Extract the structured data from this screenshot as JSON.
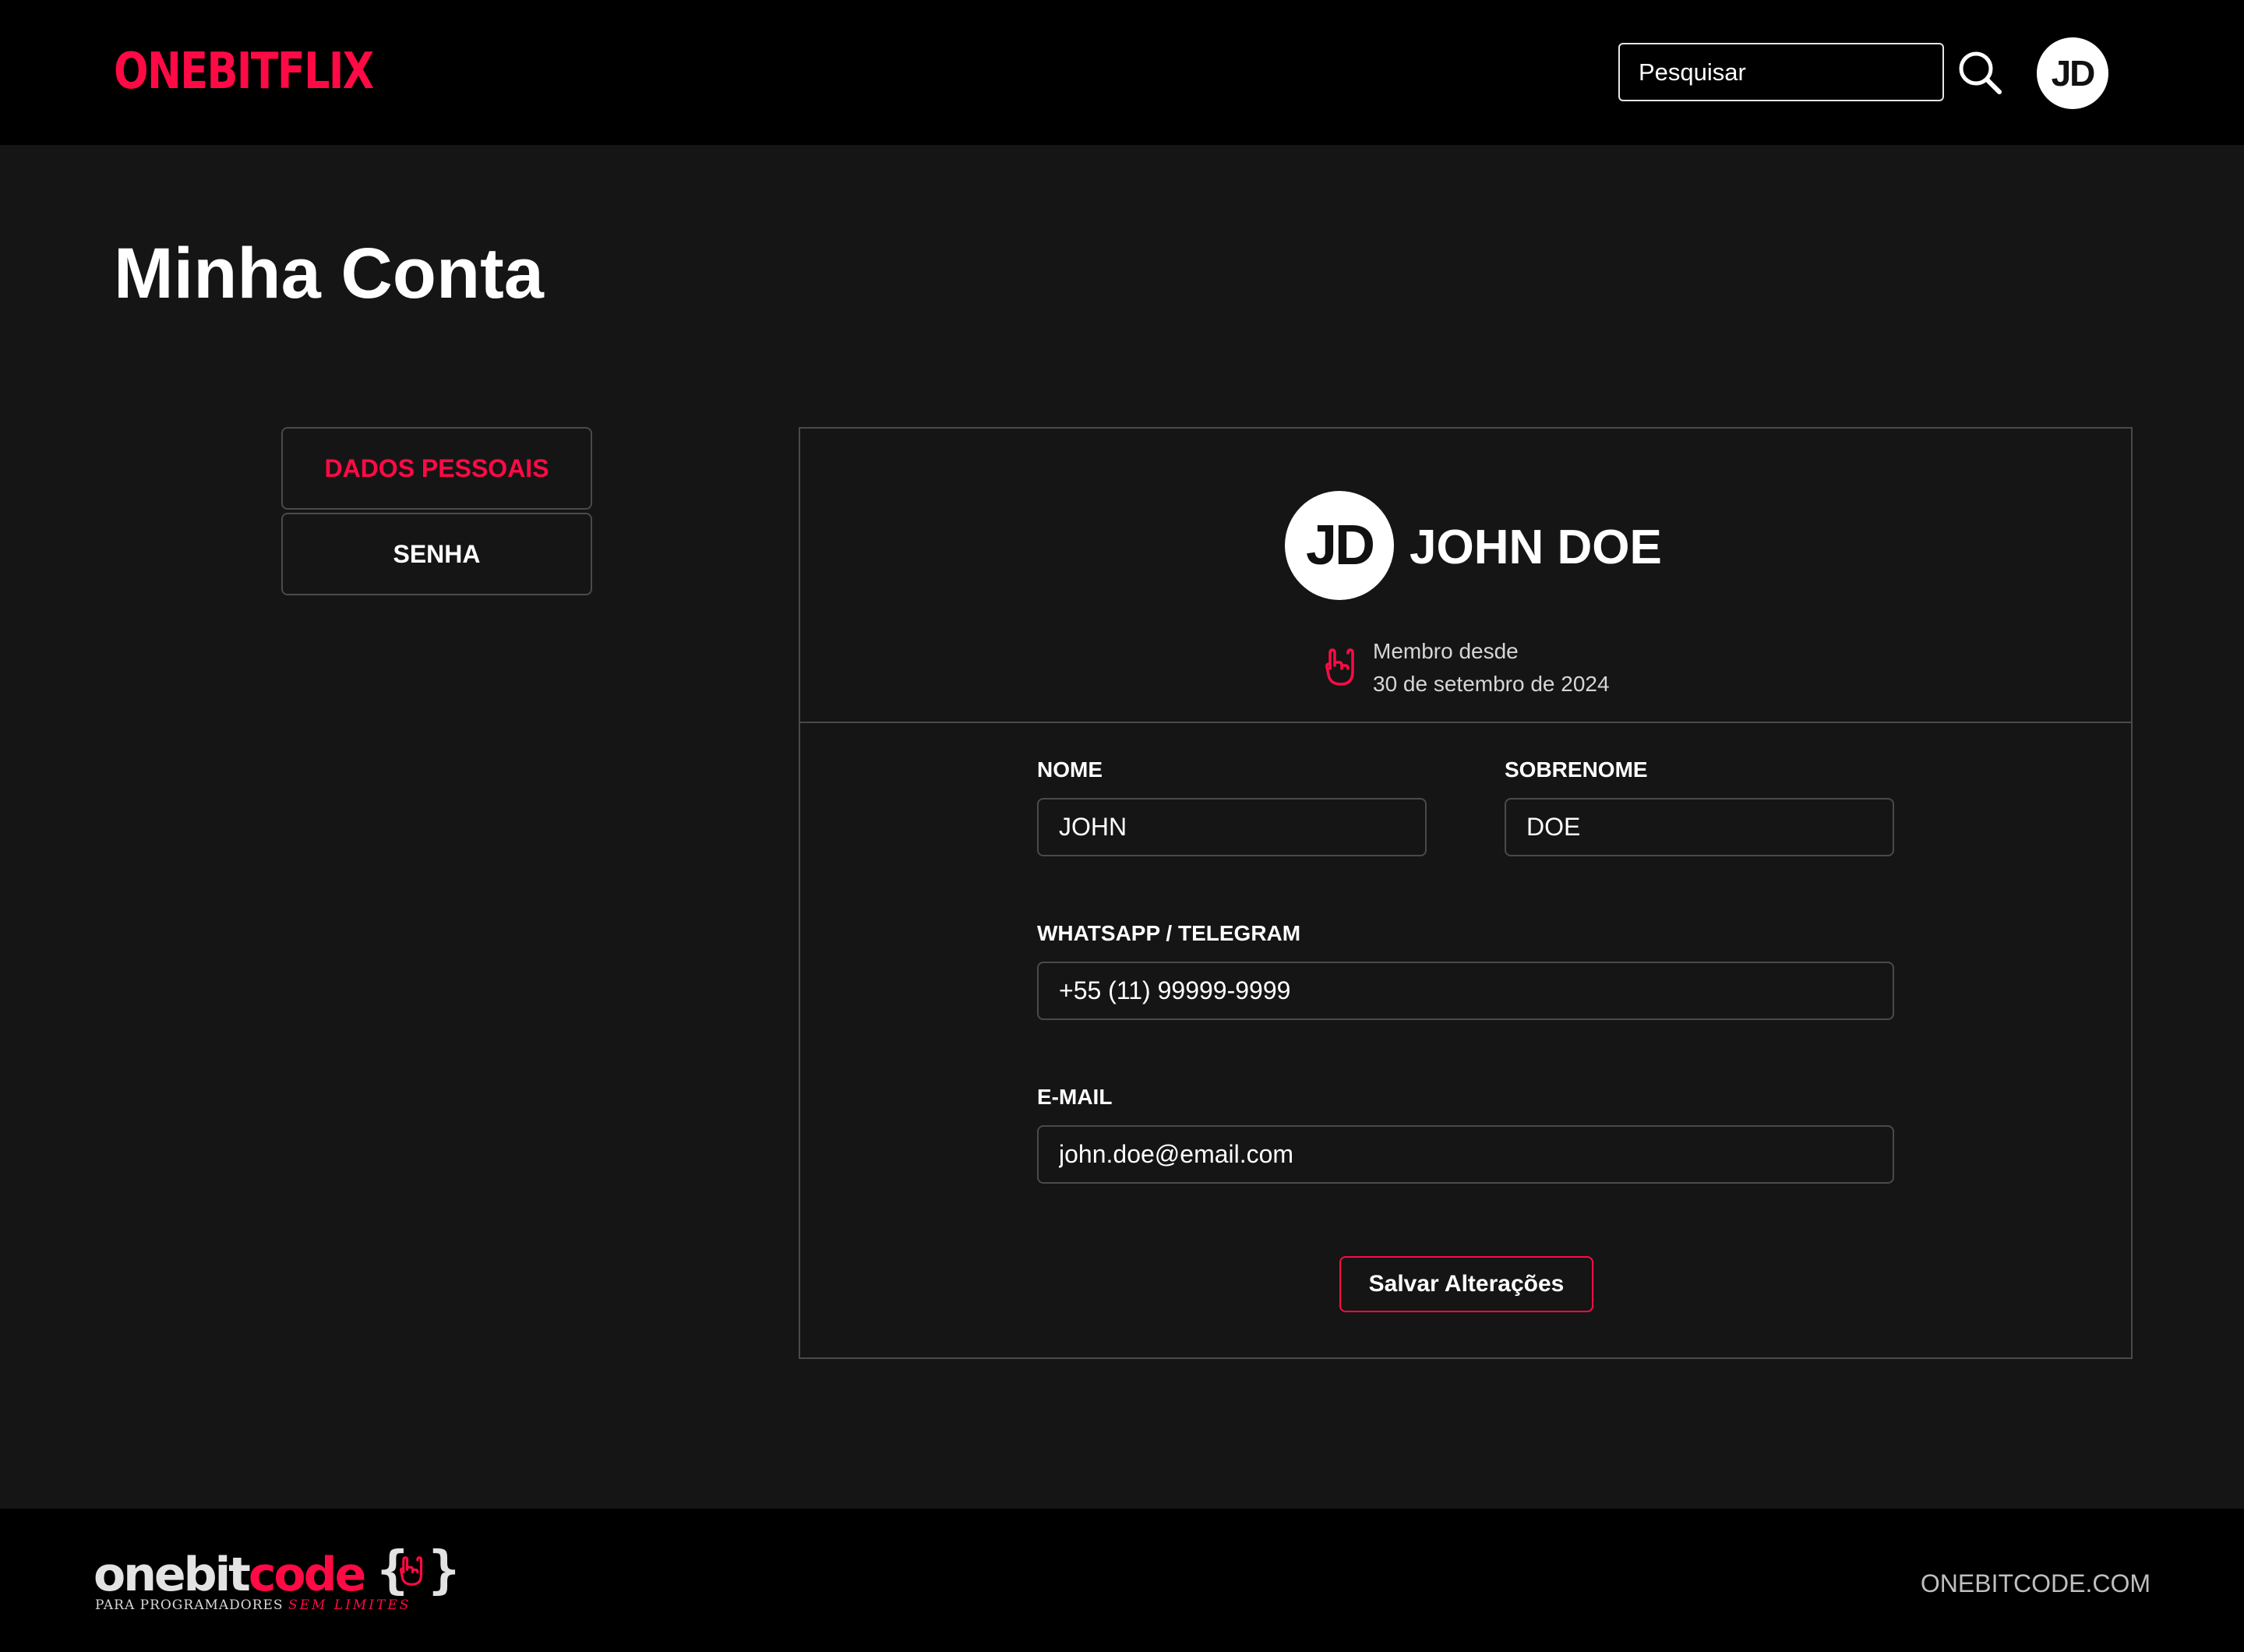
{
  "header": {
    "logo": "ONEBITFLIX",
    "search_placeholder": "Pesquisar",
    "avatar_initials": "JD"
  },
  "page": {
    "title": "Minha Conta"
  },
  "side_menu": {
    "items": [
      {
        "label": "DADOS PESSOAIS",
        "active": true
      },
      {
        "label": "SENHA",
        "active": false
      }
    ]
  },
  "profile": {
    "initials": "JD",
    "name": "JOHN DOE",
    "member_since_label": "Membro desde",
    "member_since_date": "30 de setembro de 2024"
  },
  "form": {
    "first_name": {
      "label": "NOME",
      "value": "JOHN"
    },
    "last_name": {
      "label": "SOBRENOME",
      "value": "DOE"
    },
    "phone": {
      "label": "WHATSAPP / TELEGRAM",
      "value": "+55 (11) 99999-9999"
    },
    "email": {
      "label": "E-MAIL",
      "value": "john.doe@email.com"
    },
    "save_label": "Salvar Alterações"
  },
  "footer": {
    "logo_part1": "onebit",
    "logo_part2": "code",
    "brace_open": "{",
    "brace_close": "}",
    "tagline_part1": "PARA PROGRAMADORES",
    "tagline_part2": "SEM LIMITES",
    "link": "ONEBITCODE.COM"
  },
  "colors": {
    "accent": "#ff0a45",
    "background": "#151515",
    "header_footer": "#000000",
    "border": "#4a4a4a"
  },
  "icons": {
    "search": "search-icon",
    "rock_hand": "rock-hand-icon"
  }
}
